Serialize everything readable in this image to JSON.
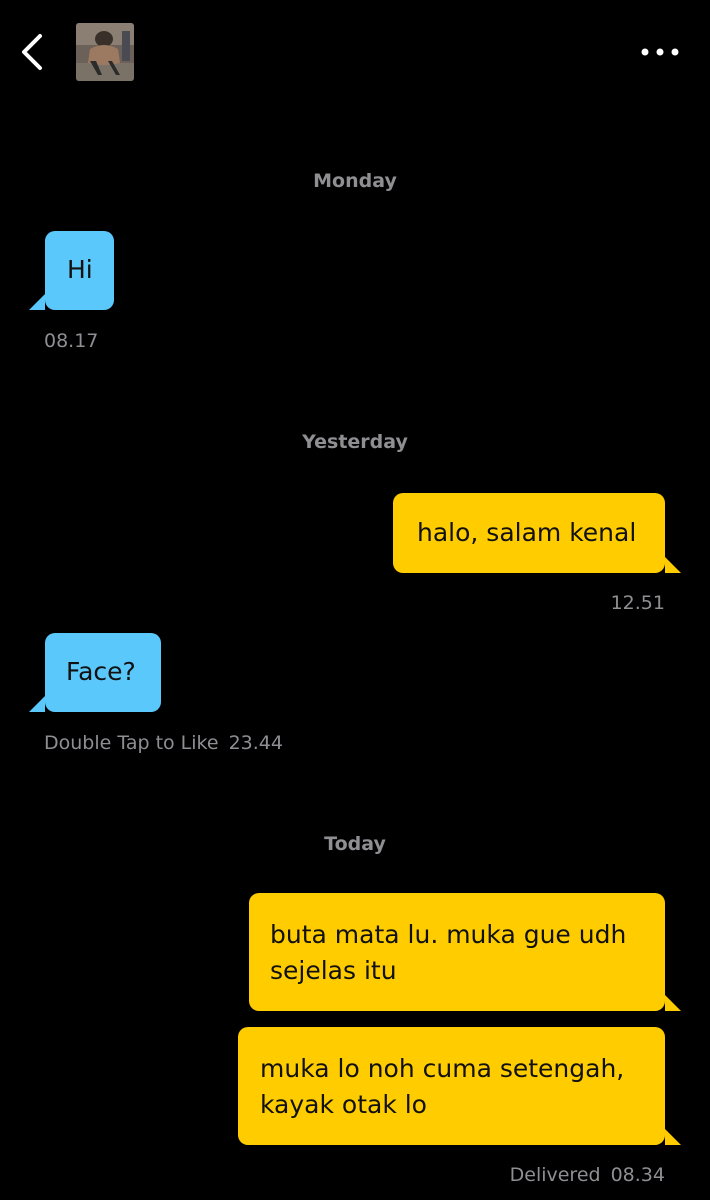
{
  "header": {
    "back_icon": "chevron-left-icon",
    "avatar_icon": "profile-photo",
    "more_icon": "more-horizontal-icon"
  },
  "colors": {
    "background": "#000000",
    "incoming_bubble": "#5ac8fa",
    "outgoing_bubble": "#ffcc00",
    "meta_text": "#8e8e93"
  },
  "days": {
    "monday": "Monday",
    "yesterday": "Yesterday",
    "today": "Today"
  },
  "messages": [
    {
      "direction": "incoming",
      "text": "Hi",
      "time": "08.17"
    },
    {
      "direction": "outgoing",
      "text": "halo, salam kenal",
      "time": "12.51"
    },
    {
      "direction": "incoming",
      "text": "Face?",
      "hint": "Double Tap to Like",
      "time": "23.44"
    },
    {
      "direction": "outgoing",
      "text": "buta mata lu. muka gue udh sejelas itu"
    },
    {
      "direction": "outgoing",
      "text": "muka lo noh cuma setengah, kayak otak lo",
      "status": "Delivered",
      "time": "08.34"
    }
  ]
}
